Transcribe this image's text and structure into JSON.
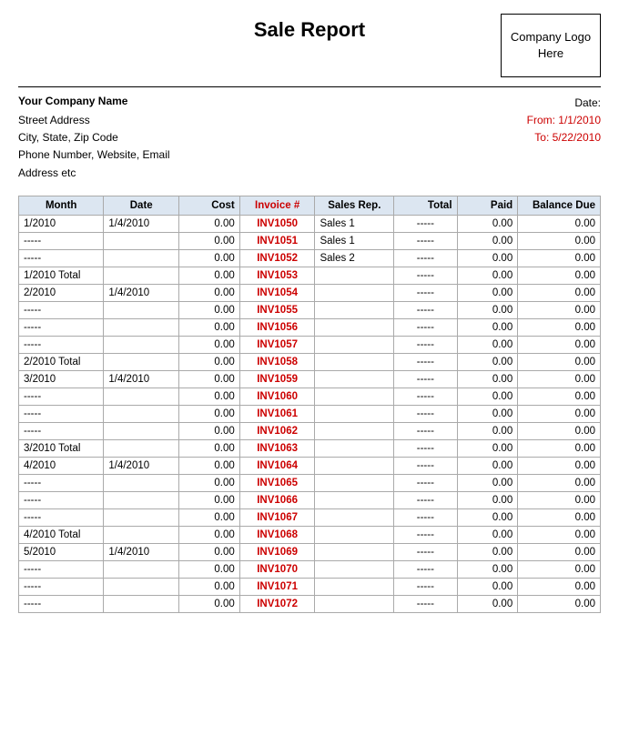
{
  "header": {
    "title": "Sale Report",
    "logo_text": "Company Logo Here"
  },
  "company": {
    "name": "Your Company Name",
    "address_line1": "Street Address",
    "address_line2": "City, State, Zip Code",
    "address_line3": "Phone Number, Website, Email",
    "address_line4": "Address etc"
  },
  "dates": {
    "label": "Date:",
    "from_label": "From: 1/1/2010",
    "to_label": "To: 5/22/2010"
  },
  "table": {
    "headers": [
      "Month",
      "Date",
      "Cost",
      "Invoice #",
      "Sales Rep.",
      "Total",
      "Paid",
      "Balance Due"
    ],
    "rows": [
      {
        "month": "1/2010",
        "date": "1/4/2010",
        "cost": "0.00",
        "invoice": "INV1050",
        "salesrep": "Sales 1",
        "total": "-----",
        "paid": "0.00",
        "balance": "0.00"
      },
      {
        "month": "-----",
        "date": "",
        "cost": "0.00",
        "invoice": "INV1051",
        "salesrep": "Sales 1",
        "total": "-----",
        "paid": "0.00",
        "balance": "0.00"
      },
      {
        "month": "-----",
        "date": "",
        "cost": "0.00",
        "invoice": "INV1052",
        "salesrep": "Sales 2",
        "total": "-----",
        "paid": "0.00",
        "balance": "0.00"
      },
      {
        "month": "1/2010 Total",
        "date": "",
        "cost": "0.00",
        "invoice": "INV1053",
        "salesrep": "",
        "total": "-----",
        "paid": "0.00",
        "balance": "0.00"
      },
      {
        "month": "2/2010",
        "date": "1/4/2010",
        "cost": "0.00",
        "invoice": "INV1054",
        "salesrep": "",
        "total": "-----",
        "paid": "0.00",
        "balance": "0.00"
      },
      {
        "month": "-----",
        "date": "",
        "cost": "0.00",
        "invoice": "INV1055",
        "salesrep": "",
        "total": "-----",
        "paid": "0.00",
        "balance": "0.00"
      },
      {
        "month": "-----",
        "date": "",
        "cost": "0.00",
        "invoice": "INV1056",
        "salesrep": "",
        "total": "-----",
        "paid": "0.00",
        "balance": "0.00"
      },
      {
        "month": "-----",
        "date": "",
        "cost": "0.00",
        "invoice": "INV1057",
        "salesrep": "",
        "total": "-----",
        "paid": "0.00",
        "balance": "0.00"
      },
      {
        "month": "2/2010 Total",
        "date": "",
        "cost": "0.00",
        "invoice": "INV1058",
        "salesrep": "",
        "total": "-----",
        "paid": "0.00",
        "balance": "0.00"
      },
      {
        "month": "3/2010",
        "date": "1/4/2010",
        "cost": "0.00",
        "invoice": "INV1059",
        "salesrep": "",
        "total": "-----",
        "paid": "0.00",
        "balance": "0.00"
      },
      {
        "month": "-----",
        "date": "",
        "cost": "0.00",
        "invoice": "INV1060",
        "salesrep": "",
        "total": "-----",
        "paid": "0.00",
        "balance": "0.00"
      },
      {
        "month": "-----",
        "date": "",
        "cost": "0.00",
        "invoice": "INV1061",
        "salesrep": "",
        "total": "-----",
        "paid": "0.00",
        "balance": "0.00"
      },
      {
        "month": "-----",
        "date": "",
        "cost": "0.00",
        "invoice": "INV1062",
        "salesrep": "",
        "total": "-----",
        "paid": "0.00",
        "balance": "0.00"
      },
      {
        "month": "3/2010 Total",
        "date": "",
        "cost": "0.00",
        "invoice": "INV1063",
        "salesrep": "",
        "total": "-----",
        "paid": "0.00",
        "balance": "0.00"
      },
      {
        "month": "4/2010",
        "date": "1/4/2010",
        "cost": "0.00",
        "invoice": "INV1064",
        "salesrep": "",
        "total": "-----",
        "paid": "0.00",
        "balance": "0.00"
      },
      {
        "month": "-----",
        "date": "",
        "cost": "0.00",
        "invoice": "INV1065",
        "salesrep": "",
        "total": "-----",
        "paid": "0.00",
        "balance": "0.00"
      },
      {
        "month": "-----",
        "date": "",
        "cost": "0.00",
        "invoice": "INV1066",
        "salesrep": "",
        "total": "-----",
        "paid": "0.00",
        "balance": "0.00"
      },
      {
        "month": "-----",
        "date": "",
        "cost": "0.00",
        "invoice": "INV1067",
        "salesrep": "",
        "total": "-----",
        "paid": "0.00",
        "balance": "0.00"
      },
      {
        "month": "4/2010 Total",
        "date": "",
        "cost": "0.00",
        "invoice": "INV1068",
        "salesrep": "",
        "total": "-----",
        "paid": "0.00",
        "balance": "0.00"
      },
      {
        "month": "5/2010",
        "date": "1/4/2010",
        "cost": "0.00",
        "invoice": "INV1069",
        "salesrep": "",
        "total": "-----",
        "paid": "0.00",
        "balance": "0.00"
      },
      {
        "month": "-----",
        "date": "",
        "cost": "0.00",
        "invoice": "INV1070",
        "salesrep": "",
        "total": "-----",
        "paid": "0.00",
        "balance": "0.00"
      },
      {
        "month": "-----",
        "date": "",
        "cost": "0.00",
        "invoice": "INV1071",
        "salesrep": "",
        "total": "-----",
        "paid": "0.00",
        "balance": "0.00"
      },
      {
        "month": "-----",
        "date": "",
        "cost": "0.00",
        "invoice": "INV1072",
        "salesrep": "",
        "total": "-----",
        "paid": "0.00",
        "balance": "0.00"
      }
    ]
  }
}
